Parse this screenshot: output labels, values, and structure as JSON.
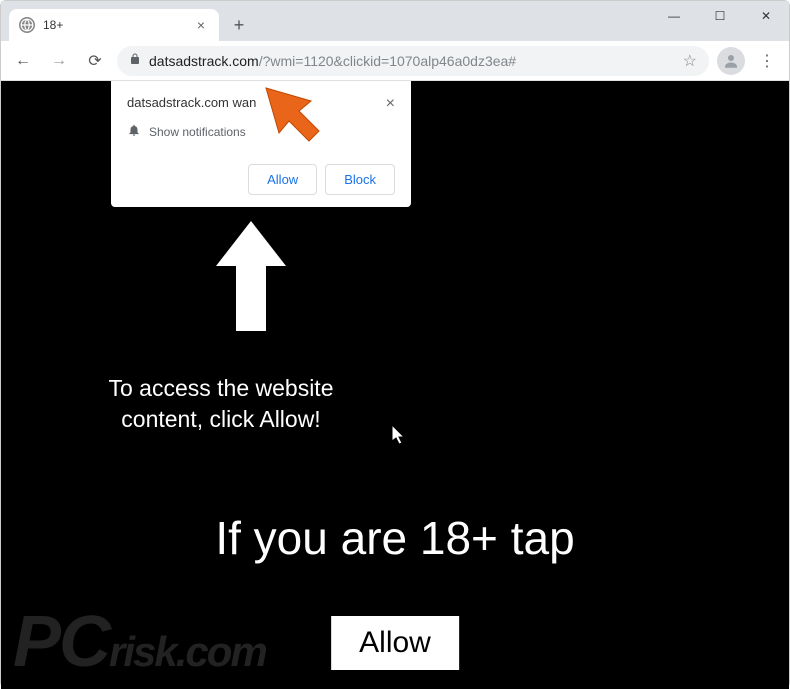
{
  "window": {
    "tab_title": "18+",
    "tab_close": "×",
    "new_tab": "+",
    "minimize": "—",
    "maximize": "☐",
    "close": "✕"
  },
  "toolbar": {
    "back": "←",
    "forward": "→",
    "reload": "⟳",
    "lock": "🔒",
    "url_domain": "datsadstrack.com",
    "url_path": "/?wmi=1120&clickid=1070alp46a0dz3ea#",
    "star": "☆",
    "avatar": "👤",
    "menu": "⋮"
  },
  "notification": {
    "title": "datsadstrack.com wan",
    "close": "×",
    "bell": "🔔",
    "subtitle": "Show notifications",
    "allow": "Allow",
    "block": "Block"
  },
  "page": {
    "instruction": "To access the website content, click Allow!",
    "age_text": "If you are 18+ tap",
    "allow_button": "Allow"
  },
  "watermark": {
    "pc": "PC",
    "rest": "risk.com"
  }
}
